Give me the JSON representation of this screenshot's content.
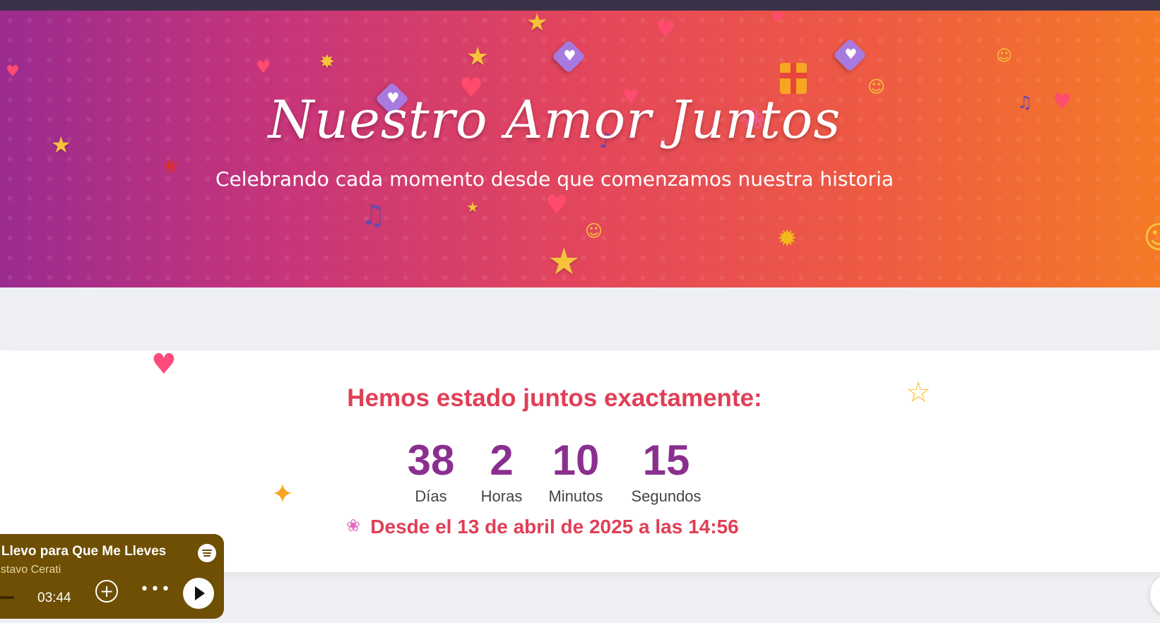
{
  "hero": {
    "title": "Nuestro Amor Juntos",
    "subtitle": "Celebrando cada momento desde que comenzamos nuestra historia"
  },
  "counter_card": {
    "heading": "Hemos estado juntos exactamente:",
    "units": [
      {
        "value": "38",
        "label": "Días"
      },
      {
        "value": "2",
        "label": "Horas"
      },
      {
        "value": "10",
        "label": "Minutos"
      },
      {
        "value": "15",
        "label": "Segundos"
      }
    ],
    "since_text": "Desde el 13 de abril de 2025 a las 14:56"
  },
  "player": {
    "song_title": "e Llevo para Que Me Lleves",
    "artist": "ustavo Cerati",
    "time": "03:44",
    "icons": [
      "spotify-logo-icon",
      "add-circle-icon",
      "more-dots-icon",
      "play-icon"
    ],
    "background_color": "#6e4f03"
  },
  "colors": {
    "hero_gradient": [
      "#9b2b8f",
      "#e3465c",
      "#f47a26"
    ],
    "heading_red": "#e03f57",
    "counter_purple": "#8b2f8f"
  }
}
